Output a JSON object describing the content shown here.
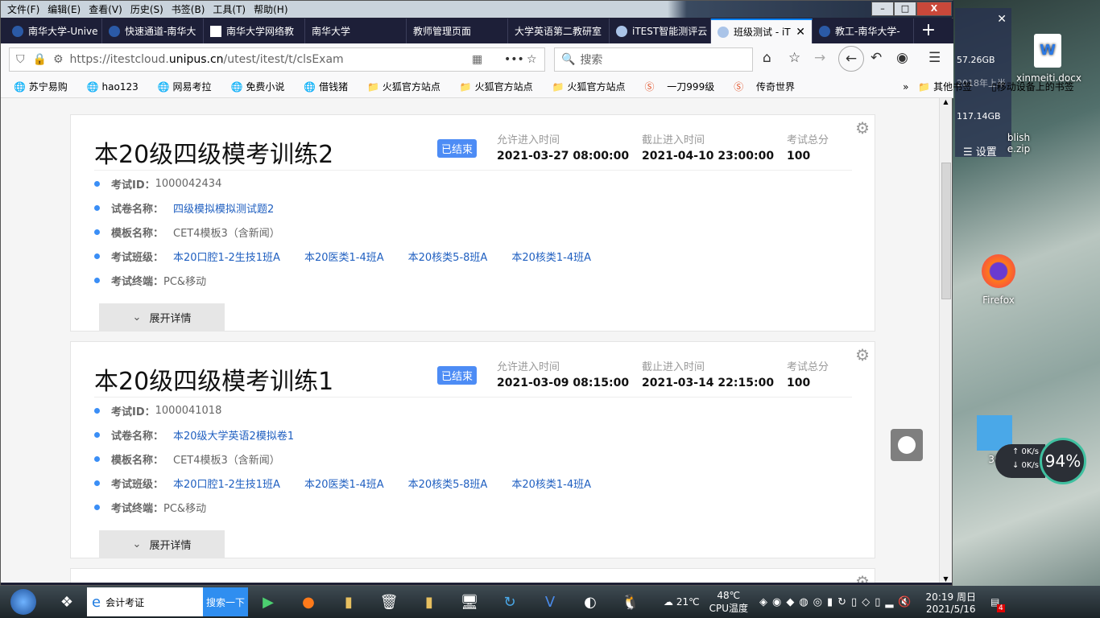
{
  "menu": [
    "文件(F)",
    "编辑(E)",
    "查看(V)",
    "历史(S)",
    "书签(B)",
    "工具(T)",
    "帮助(H)"
  ],
  "window_buttons": {
    "minimize": "–",
    "maximize": "□",
    "close": "X"
  },
  "tabs": [
    {
      "label": "南华大学-Unive"
    },
    {
      "label": "快速通道-南华大"
    },
    {
      "label": "南华大学网络教"
    },
    {
      "label": "南华大学"
    },
    {
      "label": "教师管理页面"
    },
    {
      "label": "大学英语第二教研室"
    },
    {
      "label": "iTEST智能测评云"
    },
    {
      "label": "班级测试 - iT"
    },
    {
      "label": "教工-南华大学-"
    }
  ],
  "active_tab_index": 7,
  "url": {
    "prefix": "https://itestcloud.",
    "domain": "unipus.cn",
    "path": "/utest/itest/t/clsExam"
  },
  "search_placeholder": "搜索",
  "bookmarks": [
    "苏宁易购",
    "hao123",
    "网易考拉",
    "免费小说",
    "借钱猪",
    "火狐官方站点",
    "火狐官方站点",
    "火狐官方站点",
    "一刀999级",
    "传奇世界"
  ],
  "bookmarks_right": [
    "其他书签",
    "移动设备上的书签"
  ],
  "labels": {
    "allow": "允许进入时间",
    "deadline": "截止进入时间",
    "total": "考试总分",
    "id": "考试ID：",
    "paper": "试卷名称：",
    "template": "模板名称：",
    "classes": "考试班级：",
    "terminal": "考试终端：",
    "expand": "展开详情"
  },
  "exams": [
    {
      "title": "本20级四级模考训练2",
      "status": "已结束",
      "allow": "2021-03-27 08:00:00",
      "deadline": "2021-04-10 23:00:00",
      "total": "100",
      "id": "1000042434",
      "paper": "四级模拟模拟测试题2",
      "template": "CET4模板3（含新闻）",
      "classes": [
        "本20口腔1-2生技1班A",
        "本20医类1-4班A",
        "本20核类5-8班A",
        "本20核类1-4班A"
      ],
      "terminal": "PC&移动"
    },
    {
      "title": "本20级四级模考训练1",
      "status": "已结束",
      "allow": "2021-03-09 08:15:00",
      "deadline": "2021-03-14 22:15:00",
      "total": "100",
      "id": "1000041018",
      "paper": "本20级大学英语2模拟卷1",
      "template": "CET4模板3（含新闻）",
      "classes": [
        "本20口腔1-2生技1班A",
        "本20医类1-4班A",
        "本20核类5-8班A",
        "本20核类1-4班A"
      ],
      "terminal": "PC&移动"
    }
  ],
  "taskbar": {
    "search_value": "会计考证",
    "search_button": "搜索一下",
    "weather": "21℃",
    "cpu_temp": "48℃",
    "cpu_label": "CPU温度",
    "time": "20:19 周日",
    "date": "2021/5/16",
    "notif": "4"
  },
  "desktop": {
    "icons": [
      "xinmeiti.docx",
      "Firefox",
      "blish e.zip",
      "36"
    ],
    "widget": {
      "disk1": "57.26GB",
      "disk2": "117.14GB",
      "settings": "设置",
      "note": "2018年上半"
    },
    "net_up": "0K/s",
    "net_down": "0K/s",
    "meter": "94%"
  }
}
